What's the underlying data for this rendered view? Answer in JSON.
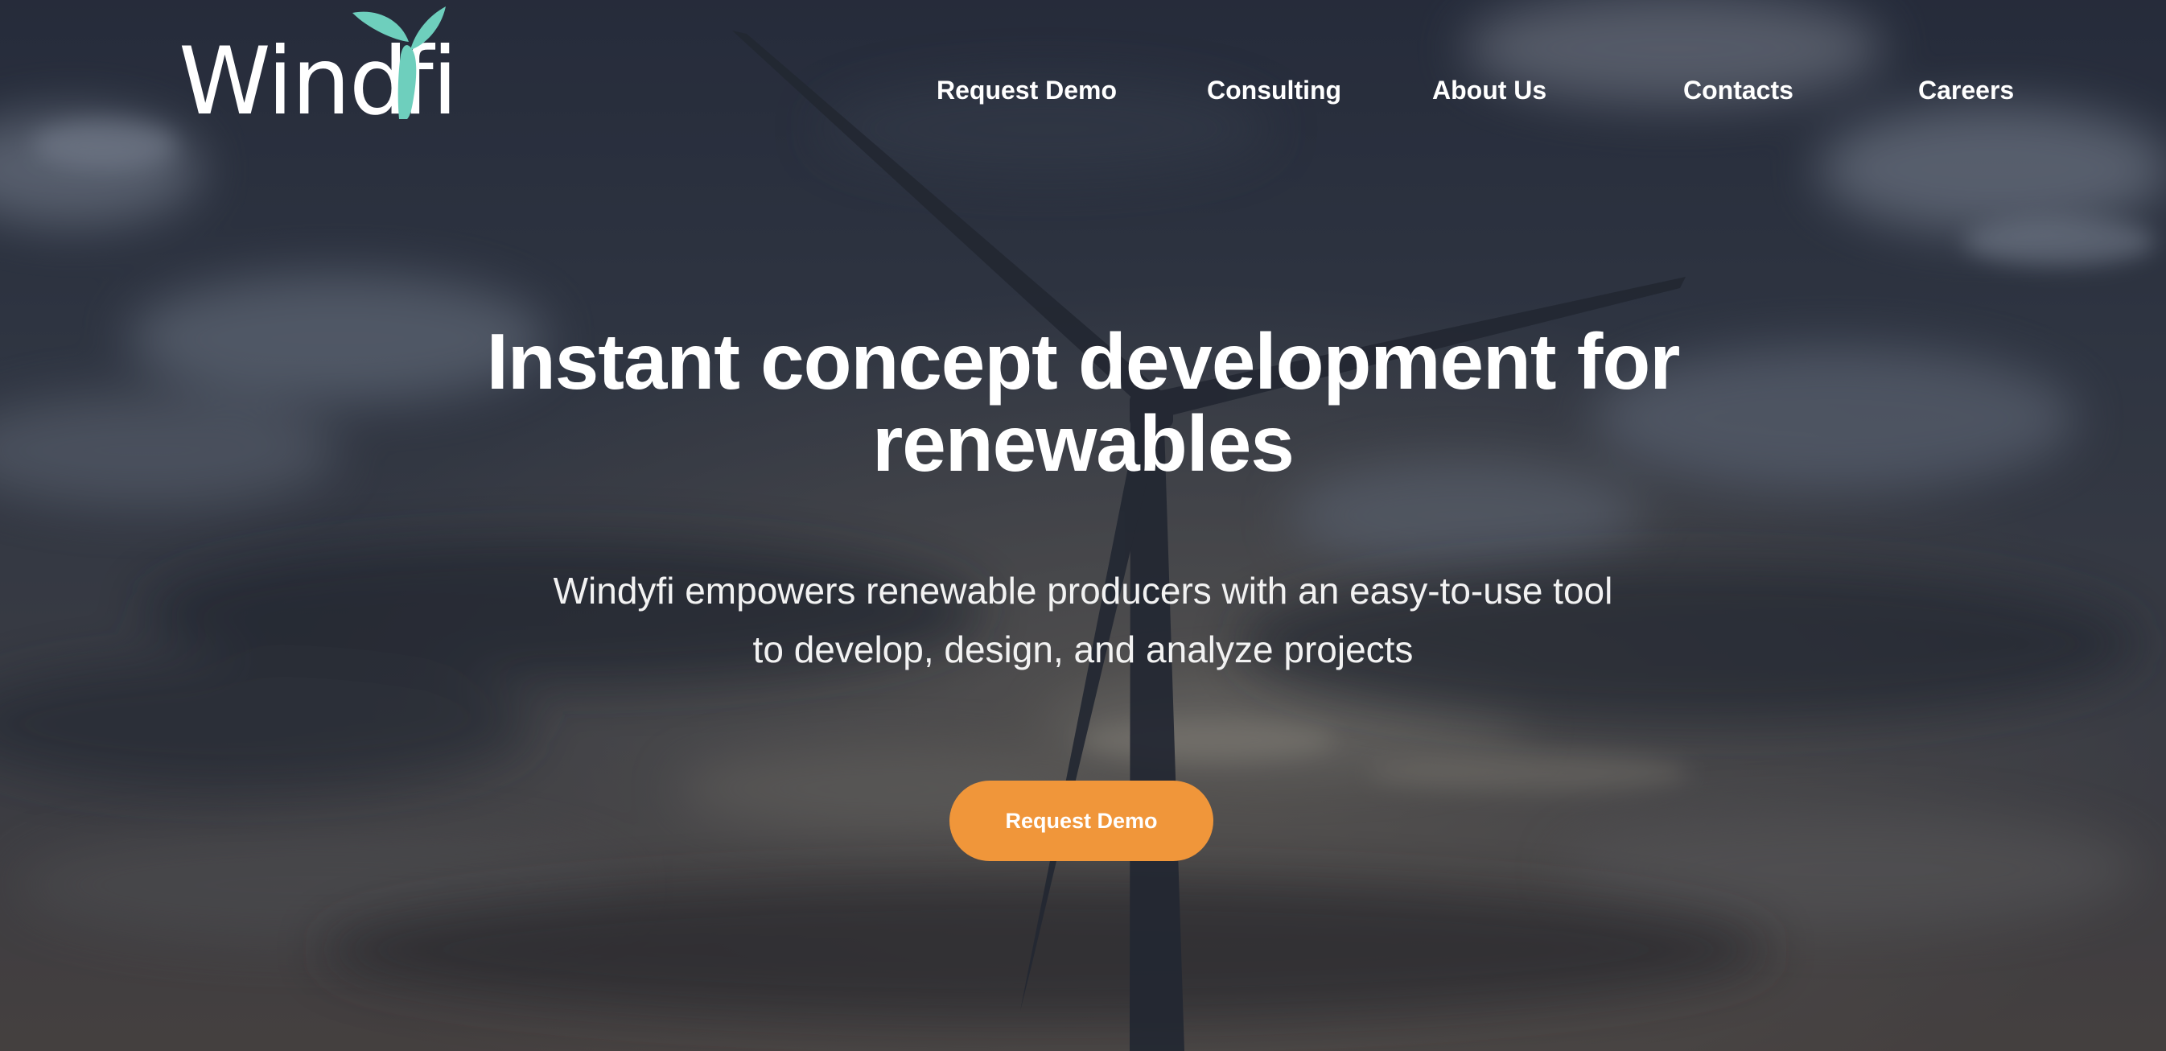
{
  "brand": {
    "logo_part1": "Wind",
    "logo_part2": "fi",
    "logo_text_color": "#ffffff",
    "logo_mark_color": "#6ecfbd"
  },
  "nav": {
    "items": [
      {
        "label": "Request Demo"
      },
      {
        "label": "Consulting"
      },
      {
        "label": "About Us"
      },
      {
        "label": "Contacts"
      },
      {
        "label": "Careers"
      }
    ]
  },
  "hero": {
    "title_line1": "Instant concept development for",
    "title_line2": "renewables",
    "subtitle_line1": "Windyfi empowers renewable producers with an easy-to-use tool",
    "subtitle_line2": "to develop, design, and analyze projects",
    "cta_label": "Request Demo",
    "background": "wind-turbine-cloudy-sky-photo"
  },
  "colors": {
    "accent": "#f0963a",
    "text": "#ffffff",
    "overlay": "#1e2330"
  }
}
